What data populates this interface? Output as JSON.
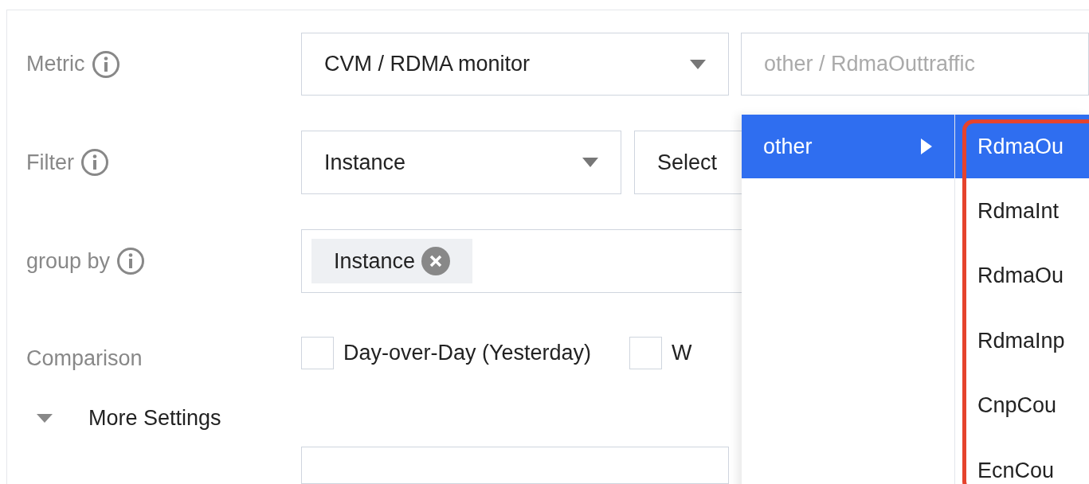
{
  "metric": {
    "label": "Metric",
    "select": {
      "value": "CVM / RDMA monitor"
    },
    "cascader": {
      "placeholder": "other / RdmaOuttraffic"
    }
  },
  "filter": {
    "label": "Filter",
    "select": {
      "value": "Instance"
    },
    "value_select": {
      "value": "Select"
    }
  },
  "group_by": {
    "label": "group by",
    "tags": [
      {
        "label": "Instance"
      }
    ]
  },
  "comparison": {
    "label": "Comparison",
    "options": [
      {
        "label": "Day-over-Day (Yesterday)",
        "checked": false
      },
      {
        "label": "W",
        "checked": false
      }
    ]
  },
  "more_settings": {
    "label": "More Settings"
  },
  "dropdown": {
    "columns": [
      {
        "items": [
          {
            "label": "other",
            "selected": true
          }
        ]
      },
      {
        "items": [
          {
            "label": "RdmaOu",
            "selected": true
          },
          {
            "label": "RdmaInt",
            "selected": false
          },
          {
            "label": "RdmaOu",
            "selected": false
          },
          {
            "label": "RdmaInp",
            "selected": false
          },
          {
            "label": "CnpCou",
            "selected": false
          },
          {
            "label": "EcnCou",
            "selected": false
          }
        ]
      }
    ]
  }
}
